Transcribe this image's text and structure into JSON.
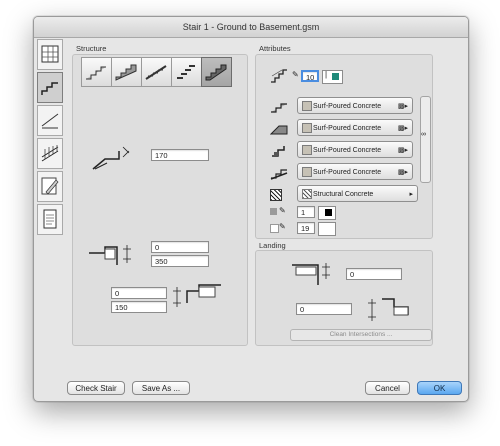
{
  "window": {
    "title": "Stair 1 - Ground to Basement.gsm"
  },
  "left_tabs": [
    {
      "name": "general-tab"
    },
    {
      "name": "structure-tab"
    },
    {
      "name": "2d-tab"
    },
    {
      "name": "railing-tab"
    },
    {
      "name": "edit-tab"
    },
    {
      "name": "document-tab"
    }
  ],
  "structure": {
    "title": "Structure",
    "stair_types": [
      "type-1",
      "type-2",
      "type-3",
      "type-4",
      "type-5"
    ],
    "selected_type_index": 4,
    "riser_height": "170",
    "landing_top": "0",
    "landing_depth": "350",
    "base_offset": "0",
    "base_height": "150"
  },
  "attributes": {
    "title": "Attributes",
    "pen_value": "10",
    "accent_color": "#1e8a7a",
    "materials": [
      {
        "label": "Surf-Poured Concrete"
      },
      {
        "label": "Surf-Poured Concrete"
      },
      {
        "label": "Surf-Poured Concrete"
      },
      {
        "label": "Surf-Poured Concrete"
      }
    ],
    "fill_label": "Structural Concrete",
    "cut_pen": "1",
    "bg_pen": "19"
  },
  "landing": {
    "title": "Landing",
    "offset_a": "0",
    "offset_b": "0",
    "clean_button": "Clean Intersections ..."
  },
  "footer": {
    "check_stair": "Check Stair",
    "save_as": "Save As ...",
    "cancel": "Cancel",
    "ok": "OK"
  }
}
